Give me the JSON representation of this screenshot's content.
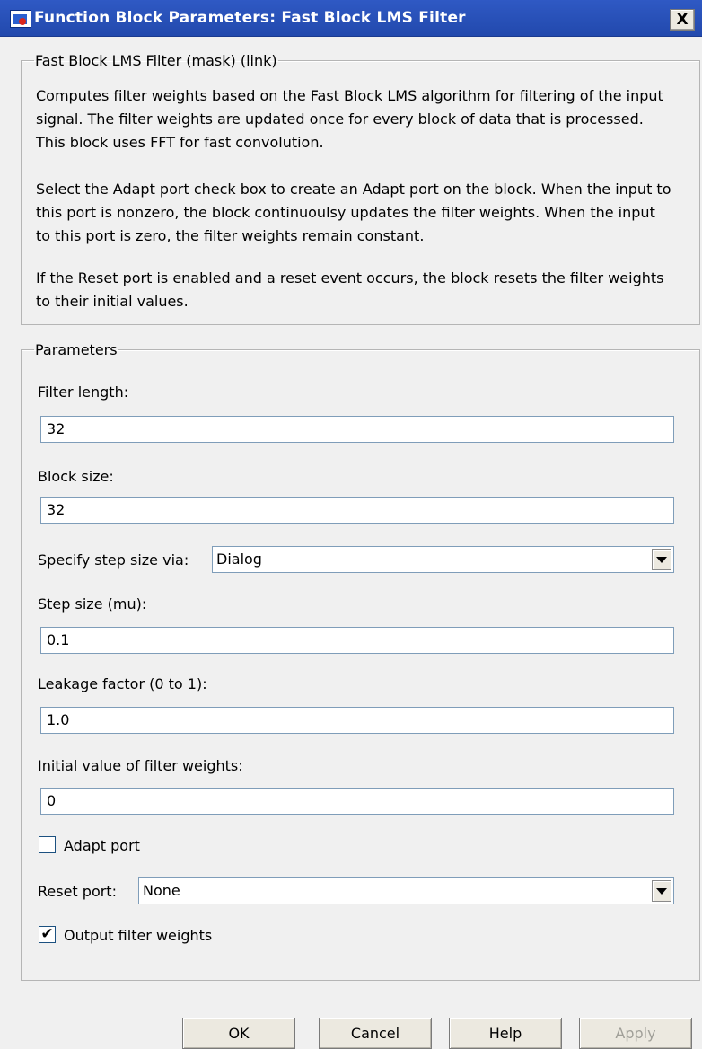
{
  "window": {
    "title": "Function Block Parameters: Fast Block LMS Filter",
    "close_glyph": "X"
  },
  "description_group": {
    "legend": "Fast Block LMS Filter (mask) (link)",
    "paragraphs": [
      "Computes filter weights based on the Fast Block LMS algorithm for filtering of the input signal. The filter weights are updated once for every block of data that is processed. This block uses FFT for fast convolution.",
      "Select the Adapt port check box to create an Adapt port on the block. When the input to this port is nonzero, the block continuoulsy updates the filter weights. When the input to this port is zero, the filter weights remain constant.",
      "If the Reset port is enabled and a reset event occurs, the block resets the filter weights to their initial values."
    ]
  },
  "parameters": {
    "legend": "Parameters",
    "filter_length": {
      "label": "Filter length:",
      "value": "32"
    },
    "block_size": {
      "label": "Block size:",
      "value": "32"
    },
    "step_size_via": {
      "label": "Specify step size via:",
      "value": "Dialog"
    },
    "step_size": {
      "label": "Step size (mu):",
      "value": "0.1"
    },
    "leakage": {
      "label": "Leakage factor (0 to 1):",
      "value": "1.0"
    },
    "initial_weights": {
      "label": "Initial value of filter weights:",
      "value": "0"
    },
    "adapt_port": {
      "label": "Adapt port",
      "checked": false
    },
    "reset_port": {
      "label": "Reset port:",
      "value": "None"
    },
    "output_weights": {
      "label": "Output filter weights",
      "checked": true,
      "mark": "✔"
    }
  },
  "buttons": {
    "ok": "OK",
    "cancel": "Cancel",
    "help": "Help",
    "apply": "Apply"
  },
  "colors": {
    "titlebar": "#2f59c4",
    "dialog_bg": "#f0f0f0",
    "field_border": "#7f9db9"
  },
  "icons": [
    "simulink-app-icon",
    "close-icon",
    "dropdown-arrow-icon",
    "checkmark-icon"
  ]
}
